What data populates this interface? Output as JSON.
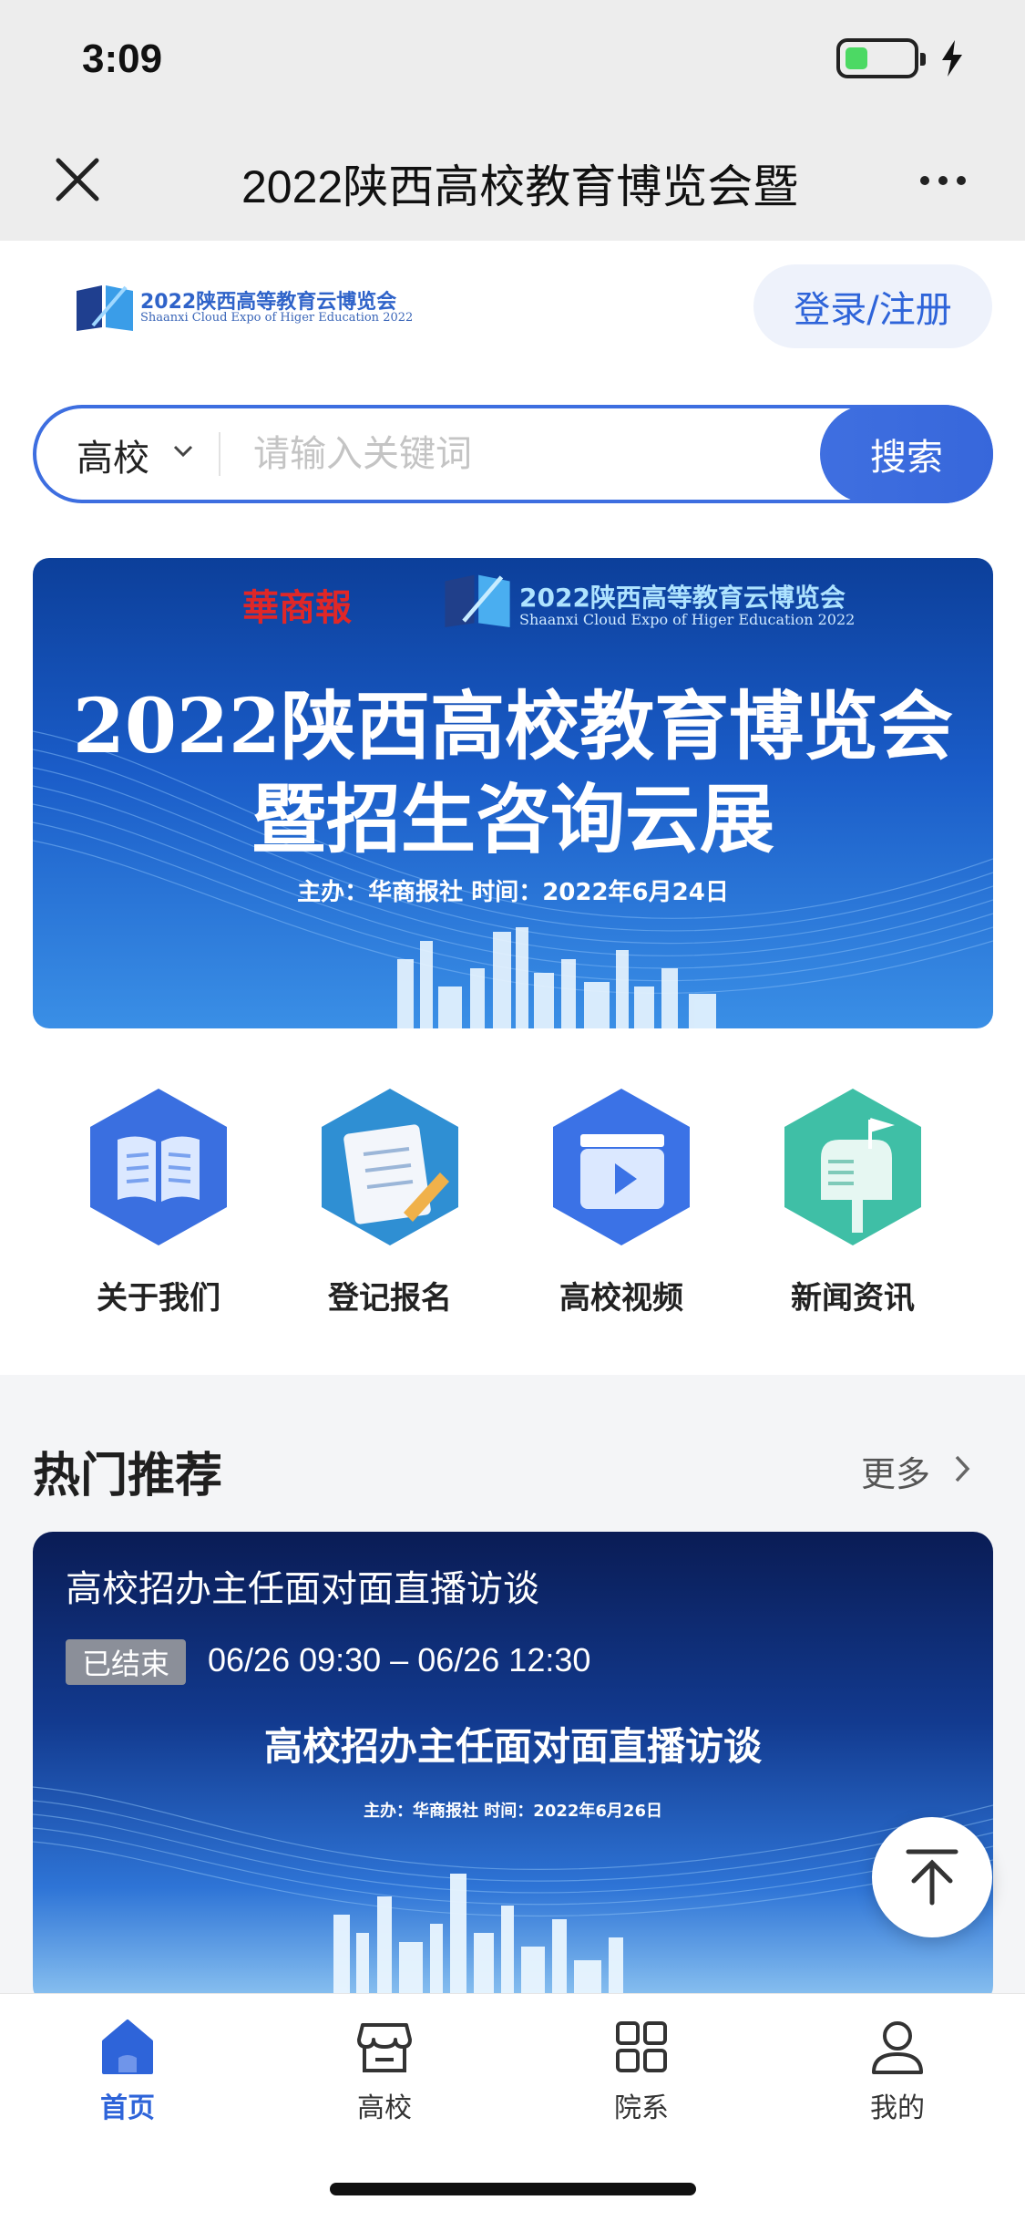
{
  "status_bar": {
    "time": "3:09"
  },
  "nav": {
    "title": "2022陕西高校教育博览会暨"
  },
  "header": {
    "logo_title": "2022陕西高等教育云博览会",
    "logo_subtitle": "Shaanxi Cloud Expo of Higer Education 2022",
    "login_label": "登录/注册"
  },
  "search": {
    "category": "高校",
    "placeholder": "请输入关键词",
    "button_label": "搜索"
  },
  "banner": {
    "brand": "華商報",
    "logo_title": "2022陕西高等教育云博览会",
    "logo_subtitle": "Shaanxi Cloud Expo of Higer Education 2022",
    "title_line1": "2022陕西高校教育博览会",
    "title_line2": "暨招生咨询云展",
    "subtitle": "主办：华商报社  时间：2022年6月24日"
  },
  "grid": [
    {
      "label": "关于我们",
      "icon": "book-icon",
      "color": "#3a6fe0"
    },
    {
      "label": "登记报名",
      "icon": "notepad-icon",
      "color": "#2f8fd3"
    },
    {
      "label": "高校视频",
      "icon": "video-icon",
      "color": "#3b72e6"
    },
    {
      "label": "新闻资讯",
      "icon": "mailbox-icon",
      "color": "#3fbfa6"
    }
  ],
  "recommend": {
    "title": "热门推荐",
    "more_label": "更多",
    "card": {
      "title": "高校招办主任面对面直播访谈",
      "status": "已结束",
      "time_range": "06/26 09:30 – 06/26 12:30",
      "inner_title": "高校招办主任面对面直播访谈",
      "inner_subtitle": "主办：华商报社  时间：2022年6月26日"
    }
  },
  "tabbar": [
    {
      "label": "首页",
      "icon": "home-icon",
      "active": true
    },
    {
      "label": "高校",
      "icon": "store-icon",
      "active": false
    },
    {
      "label": "院系",
      "icon": "grid-icon",
      "active": false
    },
    {
      "label": "我的",
      "icon": "user-icon",
      "active": false
    }
  ],
  "colors": {
    "accent": "#2e64d9",
    "badge": "#8b8f99"
  }
}
